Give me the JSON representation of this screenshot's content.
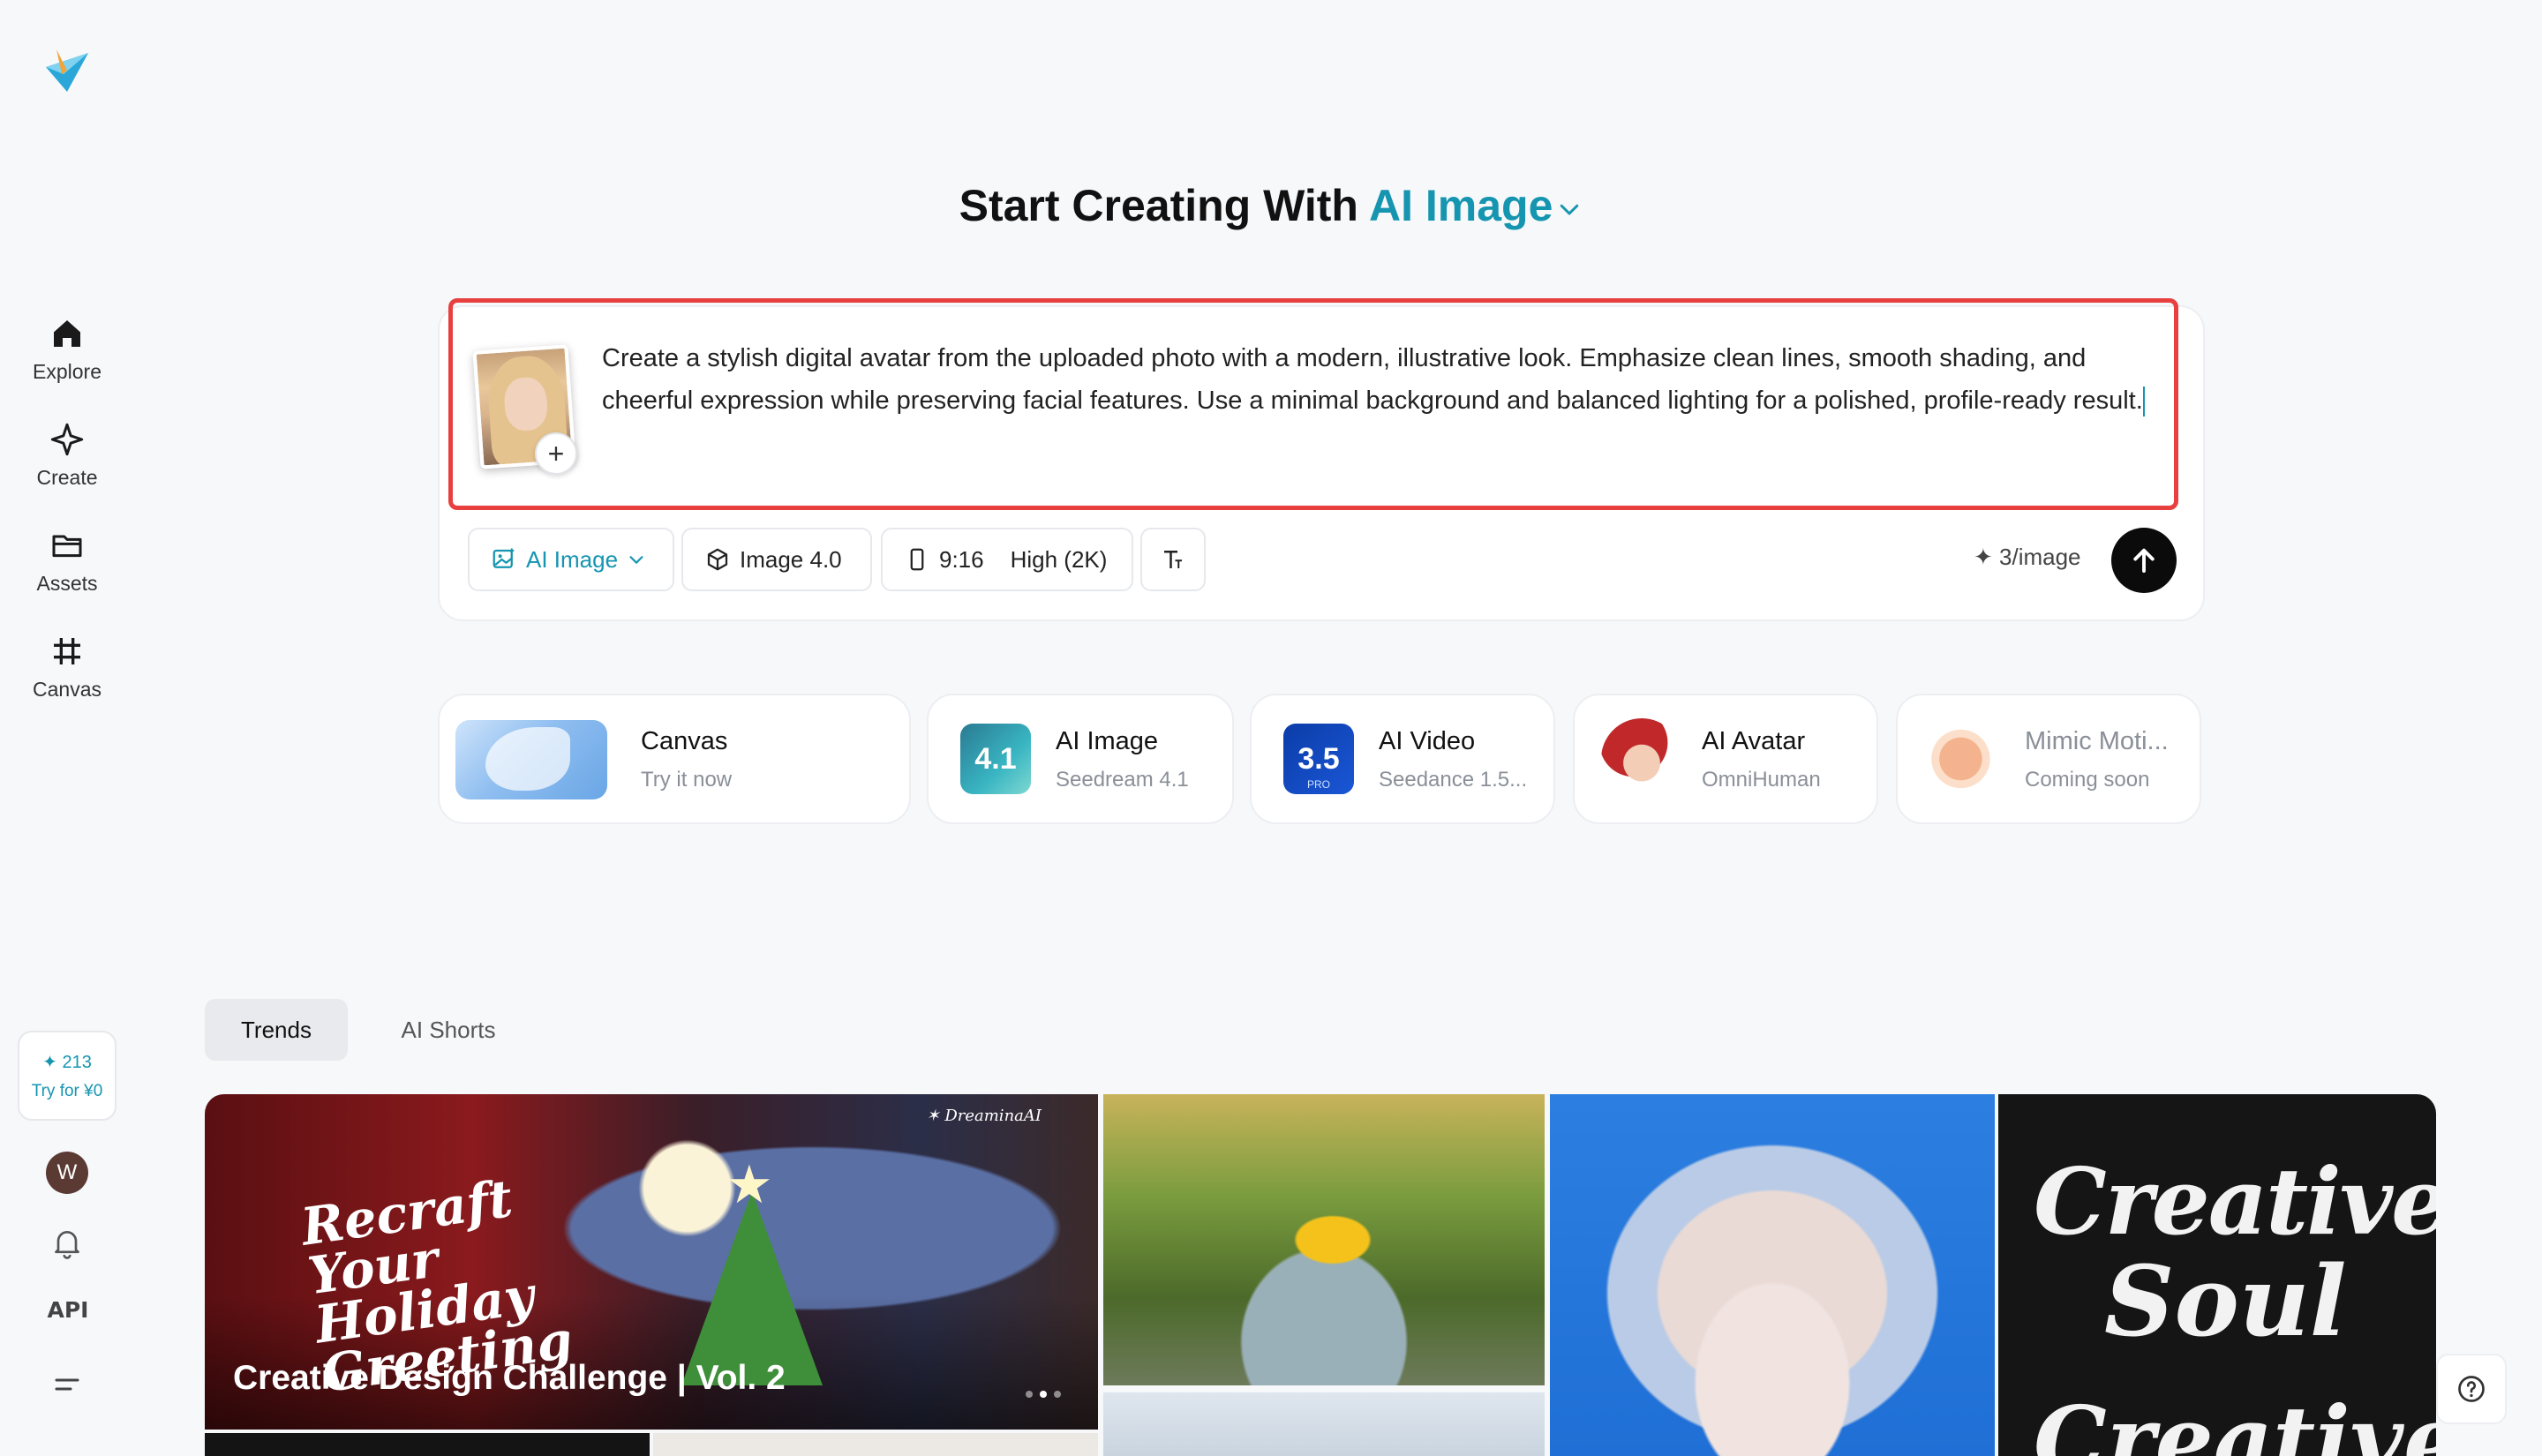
{
  "sidebar": {
    "items": [
      {
        "label": "Explore",
        "icon": "home-icon"
      },
      {
        "label": "Create",
        "icon": "sparkle-icon"
      },
      {
        "label": "Assets",
        "icon": "folder-icon"
      },
      {
        "label": "Canvas",
        "icon": "crop-icon"
      }
    ],
    "credits": "✦ 213",
    "try_label": "Try for ¥0",
    "avatar_initial": "W",
    "api_label": "API"
  },
  "heading": {
    "prefix": "Start Creating With",
    "mode": "AI Image"
  },
  "prompt": {
    "text": "Create a stylish digital avatar from the uploaded photo with a modern, illustrative look. Emphasize clean lines, smooth shading, and cheerful expression while preserving facial features. Use a minimal background and balanced lighting for a polished, profile-ready result."
  },
  "toolbar": {
    "mode_label": "AI Image",
    "model_label": "Image 4.0",
    "ratio_label": "9:16",
    "quality_label": "High (2K)",
    "cost_label": "✦ 3/image"
  },
  "tools": [
    {
      "title": "Canvas",
      "subtitle": "Try it now"
    },
    {
      "title": "AI Image",
      "subtitle": "Seedream 4.1",
      "badge": "4.1"
    },
    {
      "title": "AI Video",
      "subtitle": "Seedance 1.5...",
      "badge": "3.5",
      "badge_sub": "PRO"
    },
    {
      "title": "AI Avatar",
      "subtitle": "OmniHuman"
    },
    {
      "title": "Mimic Moti...",
      "subtitle": "Coming soon"
    }
  ],
  "tabs": [
    {
      "label": "Trends"
    },
    {
      "label": "AI Shorts"
    }
  ],
  "gallery": {
    "featured_caption": "Creative Design Challenge | Vol. 2",
    "featured_script": "Recraft Your Holiday Greeting",
    "featured_brand": "✶ DreaminaAI",
    "poster_line1": "Creative",
    "poster_line2": "Soul",
    "poster_line3": "Creative"
  },
  "colors": {
    "accent": "#1595b0",
    "highlight_border": "#e8403f",
    "background": "#f7f8fa"
  }
}
